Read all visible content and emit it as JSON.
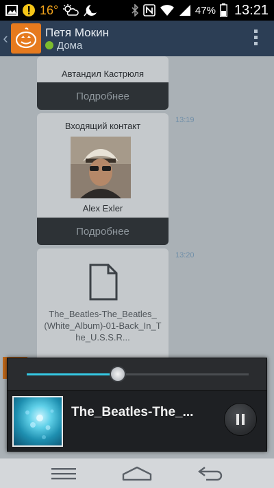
{
  "status_bar": {
    "temperature": "16°",
    "battery_percent": "47%",
    "time": "13:21",
    "icons": [
      "gallery-icon",
      "alert-icon",
      "weather-icon",
      "night-icon",
      "bluetooth-icon",
      "nfc-icon",
      "wifi-icon",
      "signal-icon",
      "battery-icon"
    ]
  },
  "action_bar": {
    "contact_name": "Петя Мокин",
    "presence_status": "Дома",
    "presence_color": "#7dbb2e",
    "avatar_color": "#e67a1e"
  },
  "chat": {
    "messages": [
      {
        "type": "contact",
        "contact_name": "Автандил Кастрюля",
        "details_label": "Подробнее"
      },
      {
        "type": "contact",
        "header": "Входящий контакт",
        "contact_name": "Alex Exler",
        "details_label": "Подробнее",
        "time": "13:19"
      },
      {
        "type": "file",
        "file_name": "The_Beatles-The_Beatles_(White_Album)-01-Back_In_The_U.S.S.R...",
        "time": "13:20"
      }
    ]
  },
  "player": {
    "track_title": "The_Beatles-The_...",
    "progress_fraction": 0.41,
    "accent_color": "#35c9e4",
    "state": "playing"
  },
  "nav_bar": {
    "buttons": [
      "menu-icon",
      "home-icon",
      "back-icon"
    ]
  }
}
